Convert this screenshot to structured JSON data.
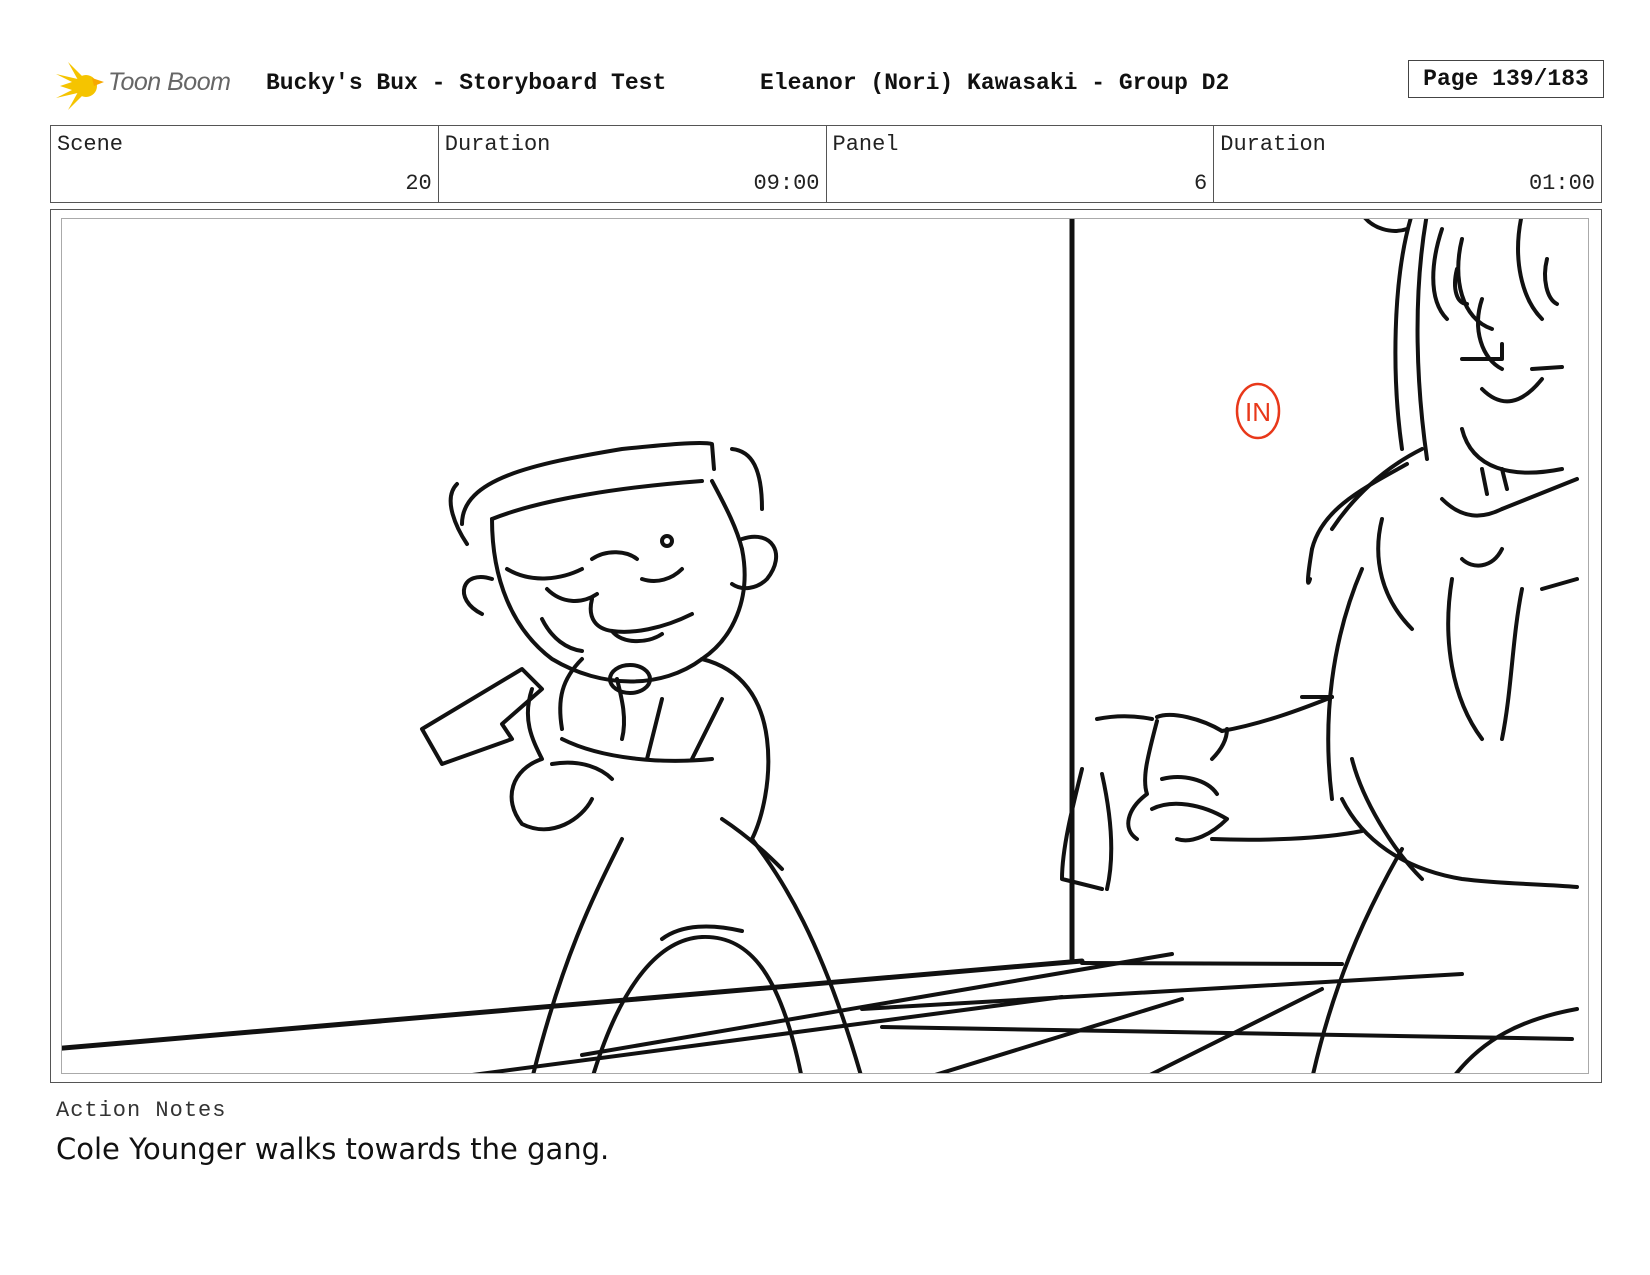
{
  "header": {
    "logo_text": "Toon Boom",
    "project_title": "Bucky's Bux - Storyboard Test",
    "author": "Eleanor (Nori) Kawasaki - Group D2",
    "page": "Page 139/183"
  },
  "info": {
    "scene_label": "Scene",
    "scene_value": "20",
    "scene_duration_label": "Duration",
    "scene_duration_value": "09:00",
    "panel_label": "Panel",
    "panel_value": "6",
    "panel_duration_label": "Duration",
    "panel_duration_value": "01:00"
  },
  "panel": {
    "sketch_stamp": "IN",
    "stamp_color": "#e8381a"
  },
  "notes": {
    "label": "Action Notes",
    "text": "Cole Younger walks towards the gang."
  },
  "colors": {
    "logo_yellow": "#f5c400",
    "logo_text": "#666666"
  }
}
